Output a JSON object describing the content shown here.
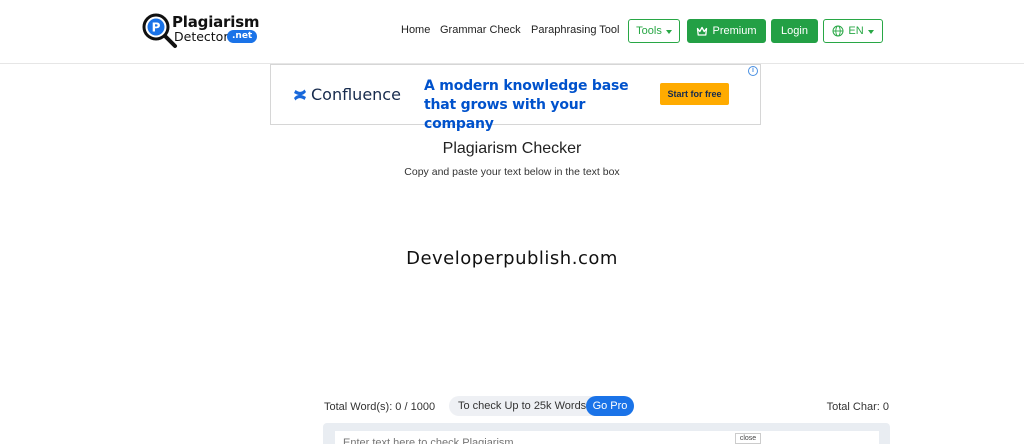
{
  "brand": {
    "name_line1": "Plagiarism",
    "name_line2": "Detector",
    "tld_badge": ".net",
    "accent": "#1a73e8"
  },
  "nav": {
    "links": [
      "Home",
      "Grammar Check",
      "Paraphrasing Tool"
    ],
    "tools_label": "Tools",
    "premium_label": "Premium",
    "login_label": "Login",
    "language_label": "EN",
    "green": "#23a045"
  },
  "ad": {
    "brand": "Confluence",
    "headline": "A modern knowledge base that grows with your company",
    "cta": "Start for free",
    "info_icon": "i"
  },
  "main": {
    "title": "Plagiarism Checker",
    "subtitle": "Copy and paste your text below in the text box",
    "watermark": "Developerpublish.com"
  },
  "counters": {
    "words": "Total Word(s): 0 / 1000",
    "pro_text": "To check Up to 25k Words",
    "go_pro": "Go Pro",
    "chars": "Total Char: 0"
  },
  "editor": {
    "placeholder": "Enter text here to check Plagiarism",
    "close_label": "close"
  }
}
